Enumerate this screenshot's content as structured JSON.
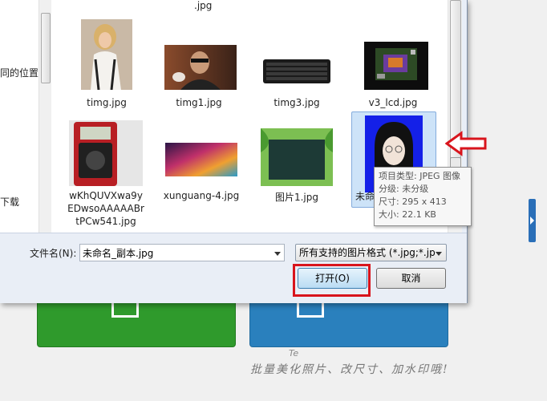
{
  "left_pane": {
    "line1": "同的位置",
    "line2": "下载"
  },
  "files": {
    "top_partial": ".jpg",
    "items": [
      {
        "name": "timg.jpg"
      },
      {
        "name": "timg1.jpg"
      },
      {
        "name": "timg3.jpg"
      },
      {
        "name": "v3_lcd.jpg"
      },
      {
        "name_lines": [
          "wKhQUVXwa9y",
          "EDwsoAAAAABr",
          "tPCw541.jpg"
        ]
      },
      {
        "name": "xunguang-4.jpg"
      },
      {
        "name": "图片1.jpg"
      },
      {
        "name": "未命名_副本.jpg",
        "selected": true
      }
    ]
  },
  "tooltip": {
    "type": "项目类型: JPEG 图像",
    "rating": "分级: 未分级",
    "dimensions": "尺寸: 295 x 413",
    "size": "大小: 22.1 KB"
  },
  "bottom": {
    "filename_label": "文件名(N):",
    "filename_value": "未命名_副本.jpg",
    "filetype_value": "所有支持的图片格式 (*.jpg;*.jp",
    "open_label": "打开(O)",
    "cancel_label": "取消"
  },
  "background": {
    "handwriting": "批量美化照片、改尺寸、加水印哦!",
    "mark": "Te"
  },
  "colors": {
    "highlight_red": "#d8141c",
    "selection": "#cde3f8",
    "tile_green": "#2f9a2c",
    "tile_blue": "#2a80bd"
  },
  "icons": [
    "red-arrow-icon",
    "dropdown-arrow-icon",
    "side-panel-toggle-icon"
  ]
}
